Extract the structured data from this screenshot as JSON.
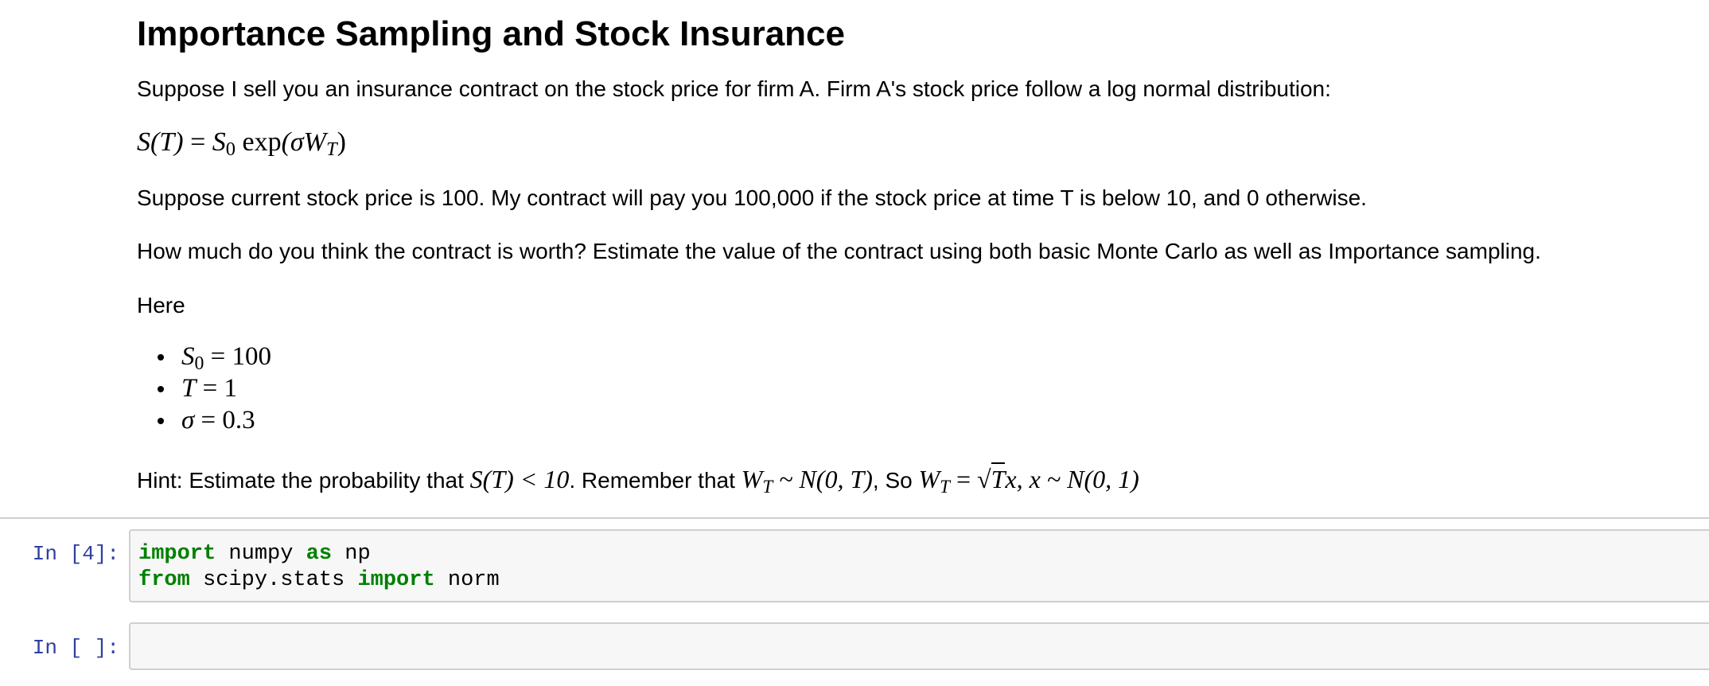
{
  "markdown": {
    "title": "Importance Sampling and Stock Insurance",
    "intro": "Suppose I sell you an insurance contract on the stock price for firm A. Firm A's stock price follow a log normal distribution:",
    "equation": {
      "lhs": "S(T)",
      "eq": " = ",
      "s": "S",
      "s_sub": "0",
      "exp": " exp",
      "open": "(σ",
      "w": "W",
      "w_sub": "T",
      "close": ")"
    },
    "para2": "Suppose current stock price is 100. My contract will pay you 100,000 if the stock price at time T is below 10, and 0 otherwise.",
    "para3": "How much do you think the contract is worth? Estimate the value of the contract using both basic Monte Carlo as well as Importance sampling.",
    "here": "Here",
    "bullets": [
      {
        "var": "S",
        "sub": "0",
        "rest": " = 100"
      },
      {
        "var": "T",
        "sub": "",
        "rest": " = 1"
      },
      {
        "var": "σ",
        "sub": "",
        "rest": " = 0.3"
      }
    ],
    "hint": {
      "text1": "Hint: Estimate the probability that ",
      "math1": "S(T) < 10",
      "text2": ". Remember that ",
      "math2_w": "W",
      "math2_sub": "T",
      "math2_rest": " ~ N(0, T)",
      "text3": ", So ",
      "math3_w": "W",
      "math3_sub": "T",
      "math3_eq": " = ",
      "math3_sqrt": "√",
      "math3_T": "T",
      "math3_rest": "x, x ~ N(0, 1)"
    }
  },
  "cells": [
    {
      "prompt": "In [4]:",
      "lines": [
        [
          {
            "t": "import",
            "k": true
          },
          {
            "t": " numpy ",
            "k": false
          },
          {
            "t": "as",
            "k": true
          },
          {
            "t": " np",
            "k": false
          }
        ],
        [
          {
            "t": "from",
            "k": true
          },
          {
            "t": " scipy.stats ",
            "k": false
          },
          {
            "t": "import",
            "k": true
          },
          {
            "t": " norm",
            "k": false
          }
        ]
      ]
    },
    {
      "prompt": "In [ ]:",
      "lines": []
    }
  ],
  "colors": {
    "keyword": "#008000",
    "prompt": "#303f9f",
    "cell_background": "#f7f7f7",
    "cell_border": "#cfcfcf"
  }
}
